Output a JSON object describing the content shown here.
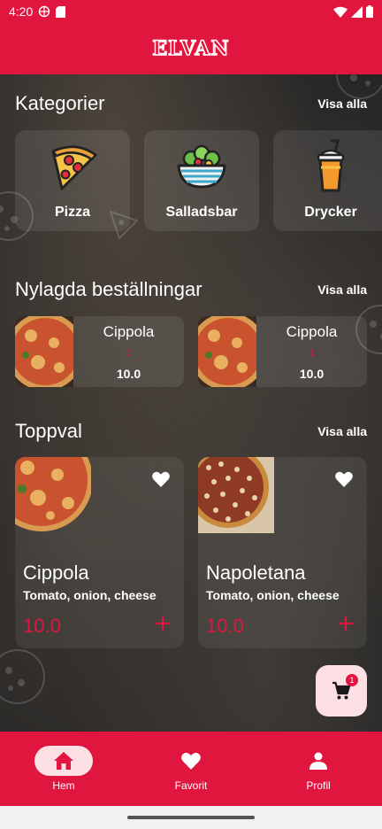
{
  "status_bar": {
    "time": "4:20"
  },
  "app": {
    "logo_text": "ELVAN"
  },
  "categories": {
    "title": "Kategorier",
    "see_all": "Visa alla",
    "items": [
      {
        "label": "Pizza",
        "icon": "pizza-slice-icon"
      },
      {
        "label": "Salladsbar",
        "icon": "salad-bowl-icon"
      },
      {
        "label": "Drycker",
        "icon": "drink-cup-icon"
      }
    ]
  },
  "recent_orders": {
    "title": "Nylagda beställningar",
    "see_all": "Visa alla",
    "items": [
      {
        "name": "Cippola",
        "quantity": "1",
        "price": "10.0"
      },
      {
        "name": "Cippola",
        "quantity": "1",
        "price": "10.0"
      }
    ]
  },
  "top_picks": {
    "title": "Toppval",
    "see_all": "Visa alla",
    "items": [
      {
        "name": "Cippola",
        "description": "Tomato, onion, cheese",
        "price": "10.0"
      },
      {
        "name": "Napoletana",
        "description": "Tomato, onion, cheese",
        "price": "10.0"
      }
    ]
  },
  "cart": {
    "badge_count": "1"
  },
  "bottom_nav": {
    "items": [
      {
        "label": "Hem",
        "icon": "home-icon",
        "active": true
      },
      {
        "label": "Favorit",
        "icon": "heart-icon",
        "active": false
      },
      {
        "label": "Profil",
        "icon": "person-icon",
        "active": false
      }
    ]
  },
  "colors": {
    "brand_red": "#e0163e",
    "pill_pink": "#fde0e3",
    "background": "#242424"
  }
}
